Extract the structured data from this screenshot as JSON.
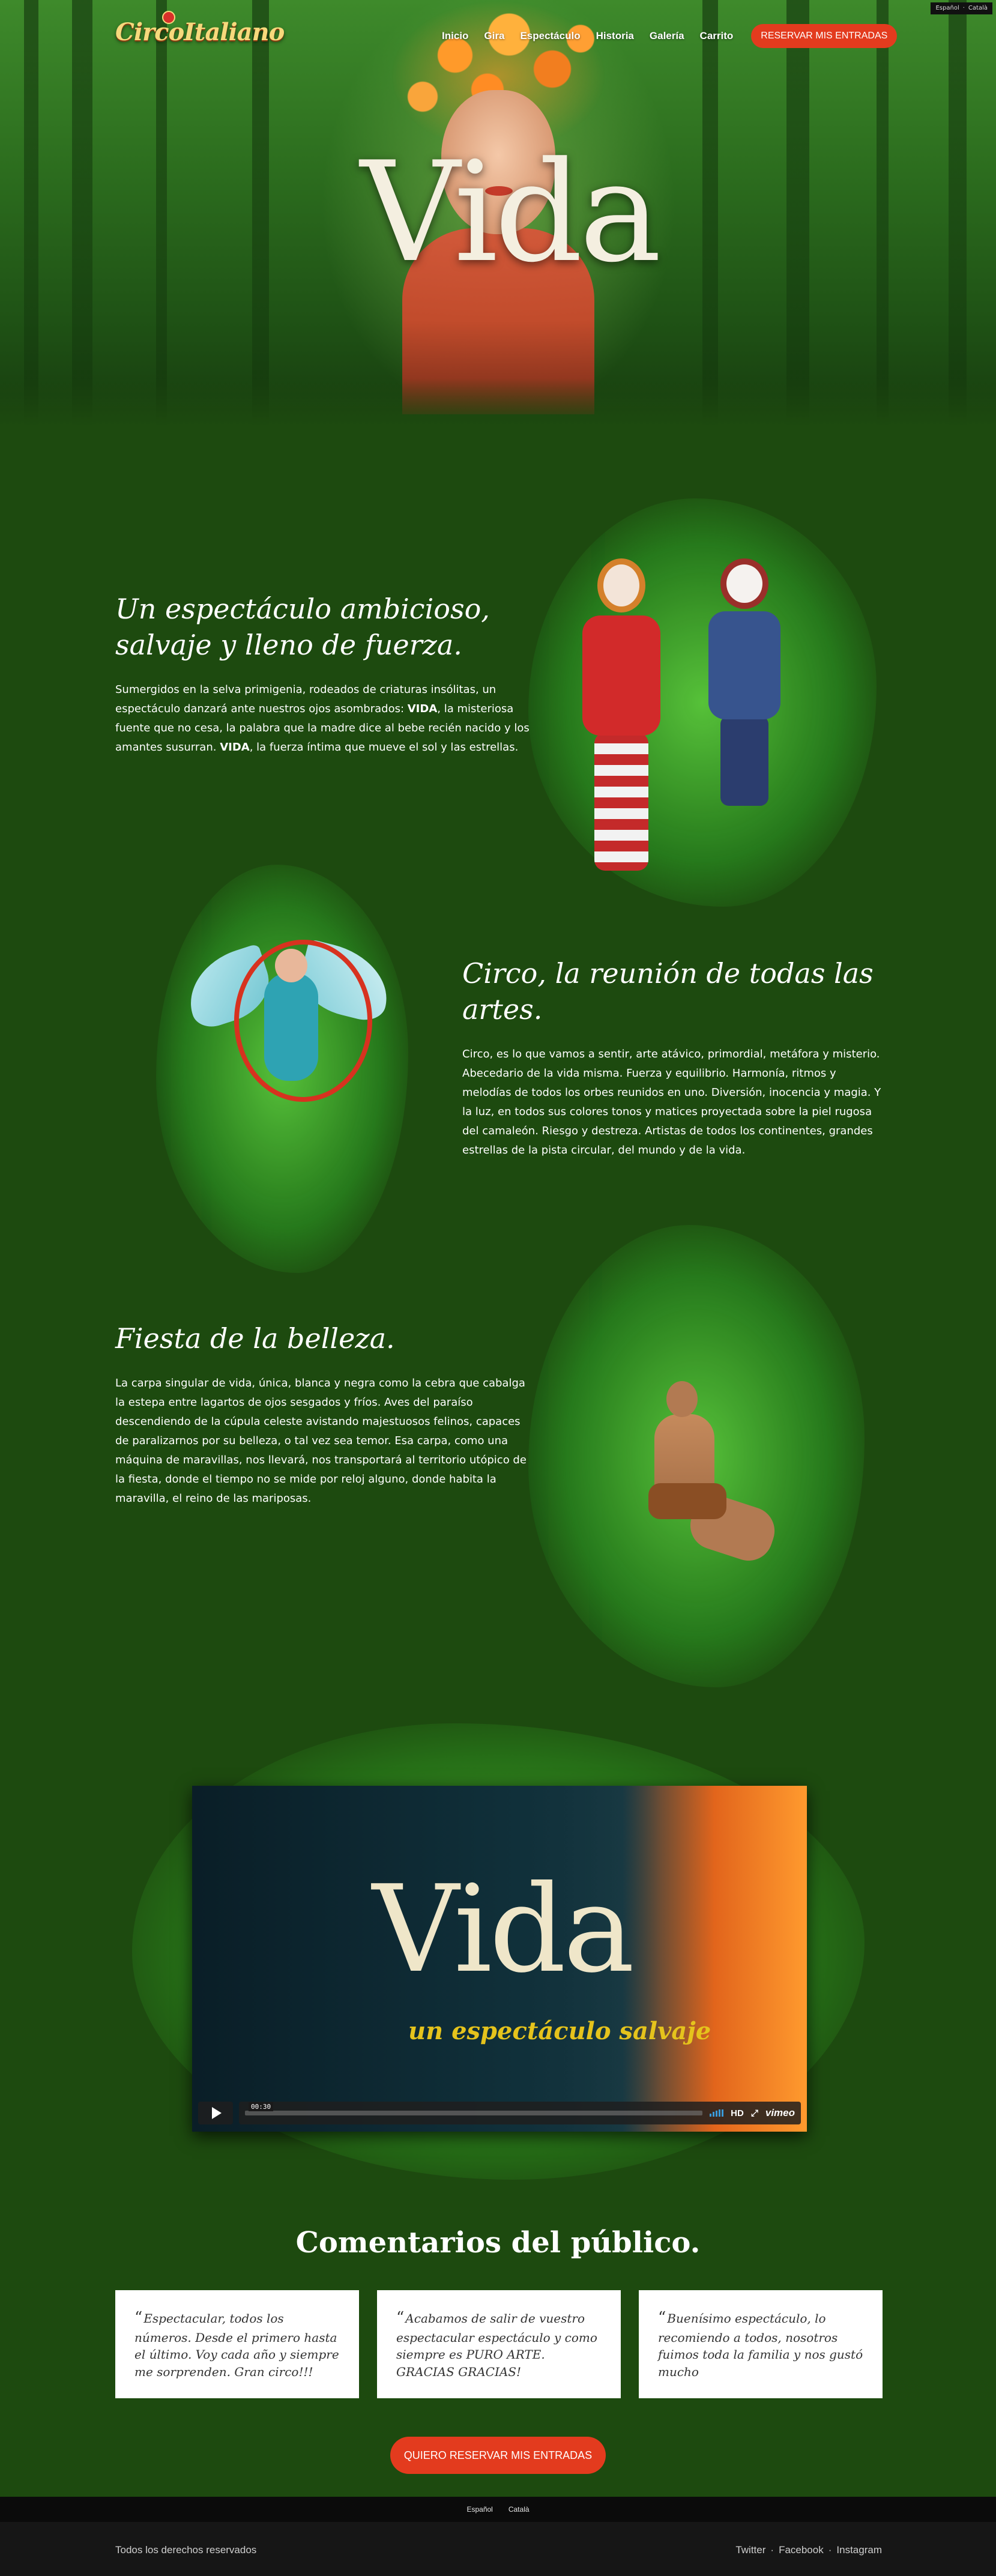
{
  "language_bar": {
    "es": "Español",
    "sep": "·",
    "ca": "Català"
  },
  "header": {
    "logo_text": "CircoItaliano",
    "nav": [
      "Inicio",
      "Gira",
      "Espectáculo",
      "Historia",
      "Galería",
      "Carrito"
    ],
    "cta": "RESERVAR MIS ENTRADAS"
  },
  "hero": {
    "title": "Vida"
  },
  "sections": [
    {
      "title_line1": "Un espectáculo ambicioso,",
      "title_line2": "salvaje y lleno de fuerza.",
      "body_pre": "Sumergidos en la selva primigenia, rodeados de criaturas insólitas, un espectáculo danzará ante nuestros ojos asombrados: ",
      "body_bold1": "VIDA",
      "body_mid": ", la misteriosa fuente que no cesa, la palabra que la madre dice al bebe recién nacido y los amantes susurran. ",
      "body_bold2": "VIDA",
      "body_post": ", la fuerza íntima que mueve el sol y las estrellas."
    },
    {
      "title_line1": "Circo, la reunión de todas las",
      "title_line2": "artes.",
      "body": "Circo, es lo que vamos a sentir, arte atávico, primordial, metáfora y misterio. Abecedario de la vida misma. Fuerza y equilibrio. Harmonía, ritmos y melodías de todos los orbes reunidos en uno. Diversión, inocencia y magia. Y la luz, en todos sus colores tonos y matices proyectada sobre la piel rugosa del camaleón. Riesgo y destreza. Artistas de todos los continentes, grandes estrellas de la pista circular, del mundo y de la vida."
    },
    {
      "title_line1": "Fiesta de la belleza.",
      "body": "La carpa singular de vida, única, blanca y negra como la cebra que cabalga la estepa entre lagartos de ojos sesgados y fríos. Aves del paraíso descendiendo de la cúpula celeste avistando majestuosos felinos, capaces de paralizarnos por su belleza, o tal vez sea temor. Esa carpa, como una máquina de maravillas, nos llevará, nos transportará al territorio utópico de la fiesta, donde el tiempo no se mide por reloj alguno, donde habita la maravilla, el reino de las mariposas."
    }
  ],
  "video": {
    "title": "Vida",
    "subtitle": "un espectáculo salvaje",
    "timecode": "00:30",
    "hd_label": "HD",
    "brand": "vimeo"
  },
  "comments": {
    "title": "Comentarios del público.",
    "items": [
      "Espectacular, todos los números. Desde el primero hasta el último. Voy cada año y siempre me sorprenden. Gran circo!!!",
      "Acabamos de salir de vuestro espectacular espectáculo y como siempre es PURO ARTE. GRACIAS GRACIAS!",
      "Buenísimo espectáculo, lo recomiendo a todos, nosotros fuimos toda la familia y nos gustó mucho"
    ],
    "cta": "QUIERO RESERVAR MIS ENTRADAS"
  },
  "footer": {
    "lang_es": "Español",
    "lang_ca": "Català",
    "copyright": "Todos los derechos reservados",
    "social": [
      "Twitter",
      "Facebook",
      "Instagram"
    ],
    "sep": "·"
  },
  "colors": {
    "accent": "#e33b1e",
    "background": "#1d4a0f",
    "card": "#ffffff"
  }
}
